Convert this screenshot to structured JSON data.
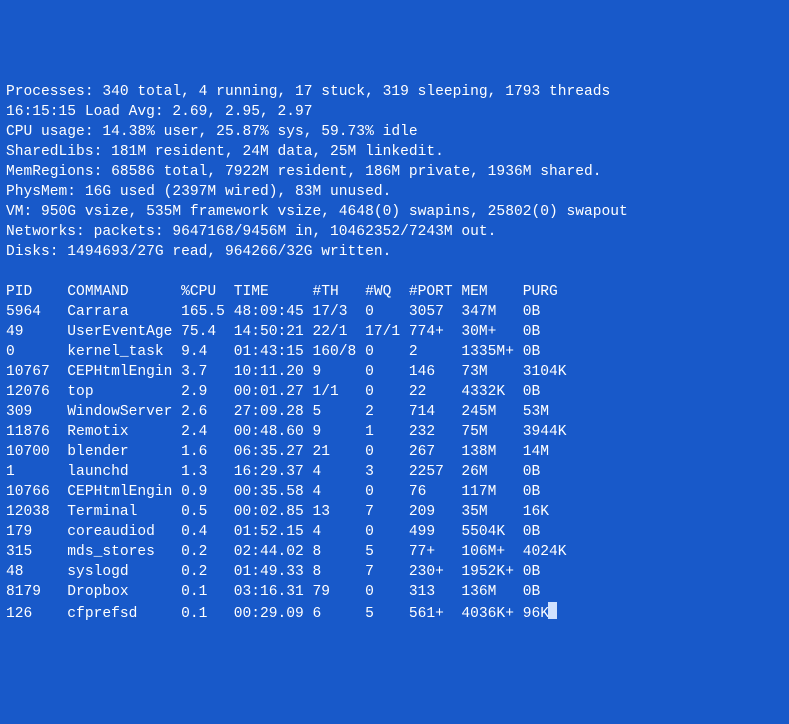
{
  "header": {
    "processes_line": "Processes: 340 total, 4 running, 17 stuck, 319 sleeping, 1793 threads",
    "time_load_line": "16:15:15 Load Avg: 2.69, 2.95, 2.97",
    "cpu_line": "CPU usage: 14.38% user, 25.87% sys, 59.73% idle",
    "sharedlibs_line": "SharedLibs: 181M resident, 24M data, 25M linkedit.",
    "memregions_line": "MemRegions: 68586 total, 7922M resident, 186M private, 1936M shared.",
    "physmem_line": "PhysMem: 16G used (2397M wired), 83M unused.",
    "vm_line": "VM: 950G vsize, 535M framework vsize, 4648(0) swapins, 25802(0) swapout",
    "networks_line": "Networks: packets: 9647168/9456M in, 10462352/7243M out.",
    "disks_line": "Disks: 1494693/27G read, 964266/32G written."
  },
  "columns": [
    "PID",
    "COMMAND",
    "%CPU",
    "TIME",
    "#TH",
    "#WQ",
    "#PORT",
    "MEM",
    "PURG"
  ],
  "rows": [
    {
      "pid": "5964",
      "command": "Carrara",
      "cpu": "165.5",
      "time": "48:09:45",
      "th": "17/3",
      "wq": "0",
      "port": "3057",
      "mem": "347M",
      "purg": "0B"
    },
    {
      "pid": "49",
      "command": "UserEventAge",
      "cpu": "75.4",
      "time": "14:50:21",
      "th": "22/1",
      "wq": "17/1",
      "port": "774+",
      "mem": "30M+",
      "purg": "0B"
    },
    {
      "pid": "0",
      "command": "kernel_task",
      "cpu": "9.4",
      "time": "01:43:15",
      "th": "160/8",
      "wq": "0",
      "port": "2",
      "mem": "1335M+",
      "purg": "0B"
    },
    {
      "pid": "10767",
      "command": "CEPHtmlEngin",
      "cpu": "3.7",
      "time": "10:11.20",
      "th": "9",
      "wq": "0",
      "port": "146",
      "mem": "73M",
      "purg": "3104K"
    },
    {
      "pid": "12076",
      "command": "top",
      "cpu": "2.9",
      "time": "00:01.27",
      "th": "1/1",
      "wq": "0",
      "port": "22",
      "mem": "4332K",
      "purg": "0B"
    },
    {
      "pid": "309",
      "command": "WindowServer",
      "cpu": "2.6",
      "time": "27:09.28",
      "th": "5",
      "wq": "2",
      "port": "714",
      "mem": "245M",
      "purg": "53M"
    },
    {
      "pid": "11876",
      "command": "Remotix",
      "cpu": "2.4",
      "time": "00:48.60",
      "th": "9",
      "wq": "1",
      "port": "232",
      "mem": "75M",
      "purg": "3944K"
    },
    {
      "pid": "10700",
      "command": "blender",
      "cpu": "1.6",
      "time": "06:35.27",
      "th": "21",
      "wq": "0",
      "port": "267",
      "mem": "138M",
      "purg": "14M"
    },
    {
      "pid": "1",
      "command": "launchd",
      "cpu": "1.3",
      "time": "16:29.37",
      "th": "4",
      "wq": "3",
      "port": "2257",
      "mem": "26M",
      "purg": "0B"
    },
    {
      "pid": "10766",
      "command": "CEPHtmlEngin",
      "cpu": "0.9",
      "time": "00:35.58",
      "th": "4",
      "wq": "0",
      "port": "76",
      "mem": "117M",
      "purg": "0B"
    },
    {
      "pid": "12038",
      "command": "Terminal",
      "cpu": "0.5",
      "time": "00:02.85",
      "th": "13",
      "wq": "7",
      "port": "209",
      "mem": "35M",
      "purg": "16K"
    },
    {
      "pid": "179",
      "command": "coreaudiod",
      "cpu": "0.4",
      "time": "01:52.15",
      "th": "4",
      "wq": "0",
      "port": "499",
      "mem": "5504K",
      "purg": "0B"
    },
    {
      "pid": "315",
      "command": "mds_stores",
      "cpu": "0.2",
      "time": "02:44.02",
      "th": "8",
      "wq": "5",
      "port": "77+",
      "mem": "106M+",
      "purg": "4024K"
    },
    {
      "pid": "48",
      "command": "syslogd",
      "cpu": "0.2",
      "time": "01:49.33",
      "th": "8",
      "wq": "7",
      "port": "230+",
      "mem": "1952K+",
      "purg": "0B"
    },
    {
      "pid": "8179",
      "command": "Dropbox",
      "cpu": "0.1",
      "time": "03:16.31",
      "th": "79",
      "wq": "0",
      "port": "313",
      "mem": "136M",
      "purg": "0B"
    },
    {
      "pid": "126",
      "command": "cfprefsd",
      "cpu": "0.1",
      "time": "00:29.09",
      "th": "6",
      "wq": "5",
      "port": "561+",
      "mem": "4036K+",
      "purg": "96K"
    }
  ],
  "chart_data": {
    "type": "table",
    "title": "top",
    "categories": [
      "PID",
      "COMMAND",
      "%CPU",
      "TIME",
      "#TH",
      "#WQ",
      "#PORT",
      "MEM",
      "PURG"
    ],
    "series": [
      {
        "name": "Carrara",
        "values": [
          "5964",
          "Carrara",
          "165.5",
          "48:09:45",
          "17/3",
          "0",
          "3057",
          "347M",
          "0B"
        ]
      },
      {
        "name": "UserEventAge",
        "values": [
          "49",
          "UserEventAge",
          "75.4",
          "14:50:21",
          "22/1",
          "17/1",
          "774+",
          "30M+",
          "0B"
        ]
      },
      {
        "name": "kernel_task",
        "values": [
          "0",
          "kernel_task",
          "9.4",
          "01:43:15",
          "160/8",
          "0",
          "2",
          "1335M+",
          "0B"
        ]
      },
      {
        "name": "CEPHtmlEngin",
        "values": [
          "10767",
          "CEPHtmlEngin",
          "3.7",
          "10:11.20",
          "9",
          "0",
          "146",
          "73M",
          "3104K"
        ]
      },
      {
        "name": "top",
        "values": [
          "12076",
          "top",
          "2.9",
          "00:01.27",
          "1/1",
          "0",
          "22",
          "4332K",
          "0B"
        ]
      },
      {
        "name": "WindowServer",
        "values": [
          "309",
          "WindowServer",
          "2.6",
          "27:09.28",
          "5",
          "2",
          "714",
          "245M",
          "53M"
        ]
      },
      {
        "name": "Remotix",
        "values": [
          "11876",
          "Remotix",
          "2.4",
          "00:48.60",
          "9",
          "1",
          "232",
          "75M",
          "3944K"
        ]
      },
      {
        "name": "blender",
        "values": [
          "10700",
          "blender",
          "1.6",
          "06:35.27",
          "21",
          "0",
          "267",
          "138M",
          "14M"
        ]
      },
      {
        "name": "launchd",
        "values": [
          "1",
          "launchd",
          "1.3",
          "16:29.37",
          "4",
          "3",
          "2257",
          "26M",
          "0B"
        ]
      },
      {
        "name": "CEPHtmlEngin",
        "values": [
          "10766",
          "CEPHtmlEngin",
          "0.9",
          "00:35.58",
          "4",
          "0",
          "76",
          "117M",
          "0B"
        ]
      },
      {
        "name": "Terminal",
        "values": [
          "12038",
          "Terminal",
          "0.5",
          "00:02.85",
          "13",
          "7",
          "209",
          "35M",
          "16K"
        ]
      },
      {
        "name": "coreaudiod",
        "values": [
          "179",
          "coreaudiod",
          "0.4",
          "01:52.15",
          "4",
          "0",
          "499",
          "5504K",
          "0B"
        ]
      },
      {
        "name": "mds_stores",
        "values": [
          "315",
          "mds_stores",
          "0.2",
          "02:44.02",
          "8",
          "5",
          "77+",
          "106M+",
          "4024K"
        ]
      },
      {
        "name": "syslogd",
        "values": [
          "48",
          "syslogd",
          "0.2",
          "01:49.33",
          "8",
          "7",
          "230+",
          "1952K+",
          "0B"
        ]
      },
      {
        "name": "Dropbox",
        "values": [
          "8179",
          "Dropbox",
          "0.1",
          "03:16.31",
          "79",
          "0",
          "313",
          "136M",
          "0B"
        ]
      },
      {
        "name": "cfprefsd",
        "values": [
          "126",
          "cfprefsd",
          "0.1",
          "00:29.09",
          "6",
          "5",
          "561+",
          "4036K+",
          "96K"
        ]
      }
    ]
  }
}
